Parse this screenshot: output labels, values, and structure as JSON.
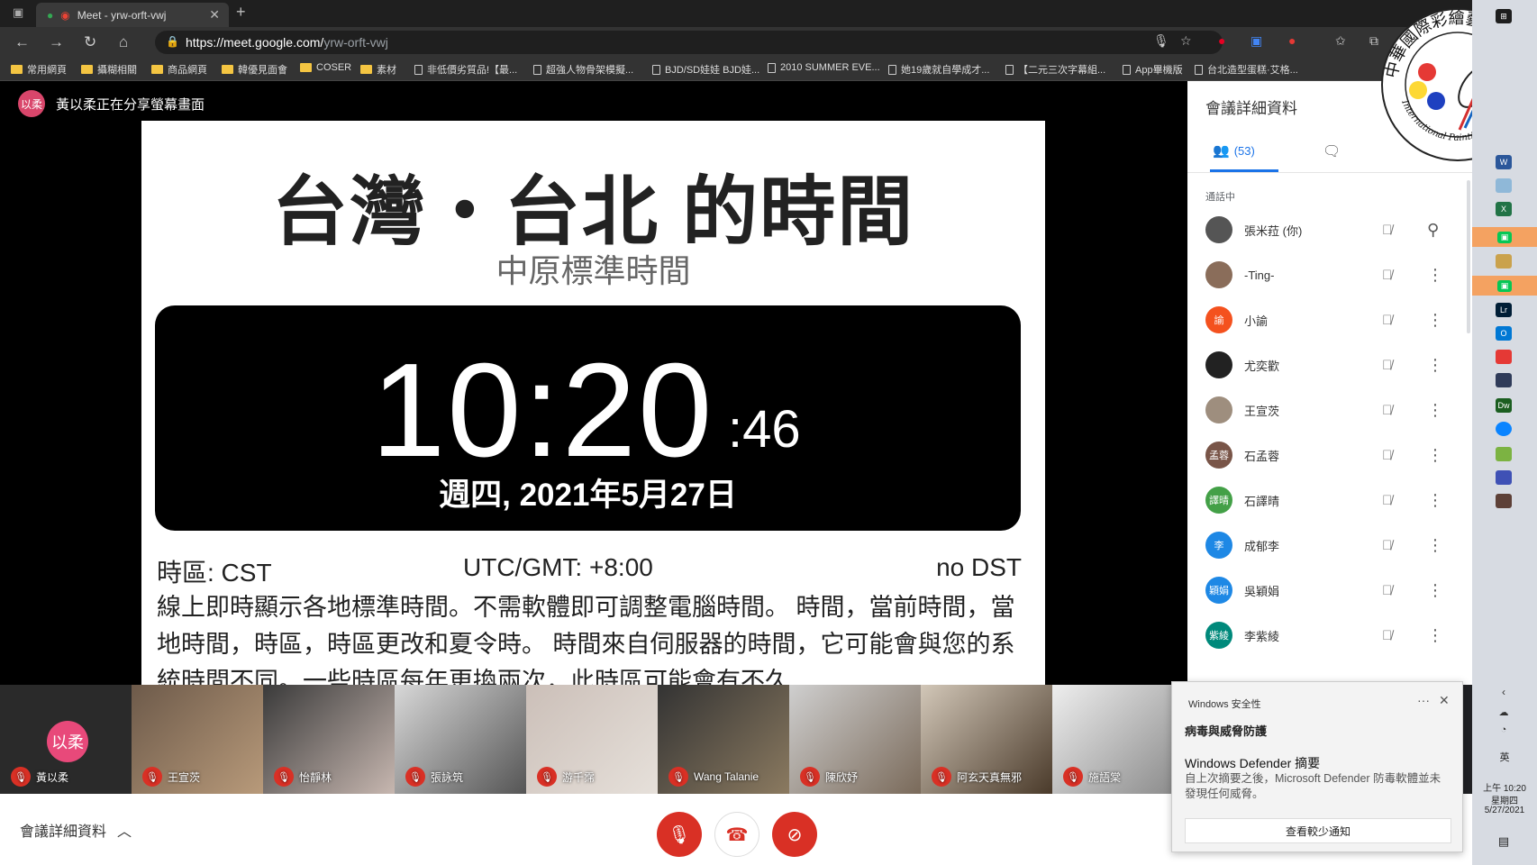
{
  "browser": {
    "tab_title": "Meet - yrw-orft-vwj",
    "url_host": "https://meet.google.com/",
    "url_path": "yrw-orft-vwj",
    "bookmarks": [
      {
        "label": "常用網頁",
        "type": "folder"
      },
      {
        "label": "攝糊相關",
        "type": "folder"
      },
      {
        "label": "商品網頁",
        "type": "folder"
      },
      {
        "label": "韓優見面會",
        "type": "folder"
      },
      {
        "label": "COSER",
        "type": "folder"
      },
      {
        "label": "素材",
        "type": "folder"
      },
      {
        "label": "非低價劣質品!【最...",
        "type": "page"
      },
      {
        "label": "超強人物骨架模擬...",
        "type": "page"
      },
      {
        "label": "BJD/SD娃娃 BJD娃...",
        "type": "page"
      },
      {
        "label": "2010 SUMMER EVE...",
        "type": "page"
      },
      {
        "label": "她19歲就自學成才...",
        "type": "page"
      },
      {
        "label": "【二元三次字幕組...",
        "type": "page"
      },
      {
        "label": "App畢機版",
        "type": "page"
      },
      {
        "label": "台北造型蛋糕·艾格...",
        "type": "page"
      }
    ]
  },
  "presenter": {
    "avatar": "以柔",
    "text": "黃以柔正在分享螢幕畫面"
  },
  "slide": {
    "title": "台灣・台北 的時間",
    "subtitle": "中原標準時間",
    "time_main": "10:20",
    "time_seconds": ":46",
    "date": "週四, 2021年5月27日",
    "timezone": "時區: CST",
    "utc": "UTC/GMT: +8:00",
    "dst": "no DST",
    "description": "線上即時顯示各地標準時間。不需軟體即可調整電腦時間。 時間，當前時間，當地時間，時區，時區更改和夏令時。 時間來自伺服器的時間，它可能會與您的系統時間不同。一些時區每年更換兩次，此時區可能會有不久"
  },
  "panel": {
    "title": "會議詳細資料",
    "people_count": "(53)",
    "section_label": "通話中",
    "participants": [
      {
        "name": "張米菈 (你)",
        "avatar": "",
        "color": "#555555"
      },
      {
        "name": "-Ting-",
        "avatar": "",
        "color": "#8a6d5a"
      },
      {
        "name": "小諭",
        "avatar": "諭",
        "color": "#f4511e"
      },
      {
        "name": "尤奕歡",
        "avatar": "",
        "color": "#222222"
      },
      {
        "name": "王宣茨",
        "avatar": "",
        "color": "#9e8e7e"
      },
      {
        "name": "石孟蓉",
        "avatar": "孟蓉",
        "color": "#795548"
      },
      {
        "name": "石譯晴",
        "avatar": "譯晴",
        "color": "#43a047"
      },
      {
        "name": "成郁李",
        "avatar": "李",
        "color": "#1e88e5"
      },
      {
        "name": "吳穎娟",
        "avatar": "穎娟",
        "color": "#1e88e5"
      },
      {
        "name": "李紫綾",
        "avatar": "紫綾",
        "color": "#00897b"
      }
    ]
  },
  "filmstrip": [
    {
      "name": "黃以柔",
      "avatar": "以柔"
    },
    {
      "name": "王宣茨",
      "avatar": ""
    },
    {
      "name": "怡靜林",
      "avatar": ""
    },
    {
      "name": "張詠筑",
      "avatar": ""
    },
    {
      "name": "游千霈",
      "avatar": ""
    },
    {
      "name": "Wang Talanie",
      "avatar": ""
    },
    {
      "name": "陳欣妤",
      "avatar": ""
    },
    {
      "name": "阿玄天真無邪",
      "avatar": ""
    },
    {
      "name": "施語棠",
      "avatar": ""
    }
  ],
  "bottombar": {
    "meeting_details": "會議詳細資料"
  },
  "toast": {
    "app": "Windows 安全性",
    "heading": "病毒與威脅防護",
    "title": "Windows Defender 摘要",
    "body": "自上次摘要之後，Microsoft Defender 防毒軟體並未發現任何威脅。",
    "button": "查看較少通知"
  },
  "taskbar": {
    "ime": "英",
    "time": "上午 10:20",
    "weekday": "星期四",
    "date": "5/27/2021"
  },
  "seal": {
    "chinese": "中華國際彩繪藝術協會",
    "english": "International Painting Artist Association"
  },
  "colors": {
    "meet_red": "#d93025",
    "meet_blue": "#1a73e8"
  }
}
